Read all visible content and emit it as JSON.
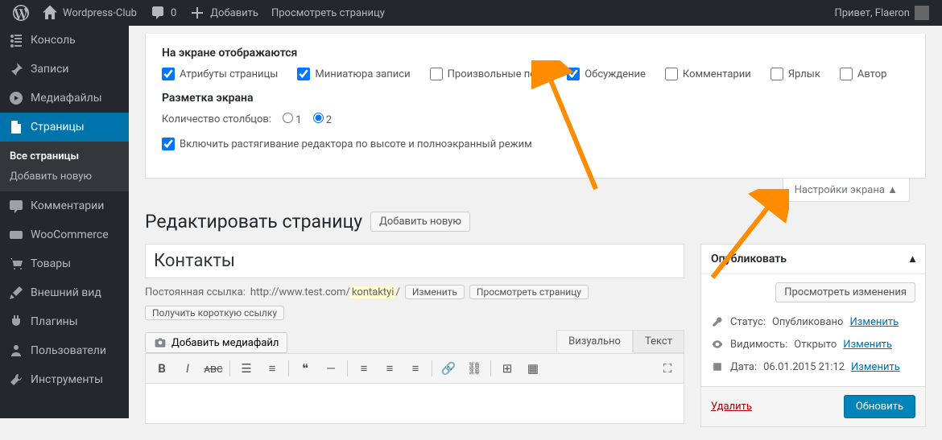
{
  "adminbar": {
    "site_name": "Wordpress-Club",
    "comments_count": "0",
    "new_label": "Добавить",
    "view_page": "Просмотреть страницу",
    "greeting": "Привет, Flaeron"
  },
  "sidebar": {
    "items": [
      {
        "label": "Консоль"
      },
      {
        "label": "Записи"
      },
      {
        "label": "Медиафайлы"
      },
      {
        "label": "Страницы"
      },
      {
        "label": "Комментарии"
      },
      {
        "label": "WooCommerce"
      },
      {
        "label": "Товары"
      },
      {
        "label": "Внешний вид"
      },
      {
        "label": "Плагины"
      },
      {
        "label": "Пользователи"
      },
      {
        "label": "Инструменты"
      }
    ],
    "submenu": {
      "all": "Все страницы",
      "add": "Добавить новую"
    }
  },
  "screen_options": {
    "heading1": "На экране отображаются",
    "checkboxes": [
      {
        "label": "Атрибуты страницы",
        "checked": true
      },
      {
        "label": "Миниатюра записи",
        "checked": true
      },
      {
        "label": "Произвольные поля",
        "checked": false
      },
      {
        "label": "Обсуждение",
        "checked": true
      },
      {
        "label": "Комментарии",
        "checked": false
      },
      {
        "label": "Ярлык",
        "checked": false
      },
      {
        "label": "Автор",
        "checked": false
      }
    ],
    "heading2": "Разметка экрана",
    "columns_label": "Количество столбцов:",
    "stretch_label": "Включить растягивание редактора по высоте и полноэкранный режим",
    "tab_label": "Настройки экрана"
  },
  "page": {
    "heading": "Редактировать страницу",
    "add_new": "Добавить новую",
    "title_value": "Контакты",
    "permalink_label": "Постоянная ссылка:",
    "permalink_url": "http://www.test.com/",
    "permalink_slug": "kontaktyi",
    "permalink_edit": "Изменить",
    "permalink_view": "Просмотреть страницу",
    "shortlink": "Получить короткую ссылку",
    "add_media": "Добавить медиафайл",
    "tab_visual": "Визуально",
    "tab_text": "Текст"
  },
  "publish": {
    "title": "Опубликовать",
    "preview": "Просмотреть изменения",
    "status_label": "Статус:",
    "status_value": "Опубликовано",
    "visibility_label": "Видимость:",
    "visibility_value": "Открыто",
    "date_label": "Дата:",
    "date_value": "06.01.2015 21:12",
    "edit": "Изменить",
    "delete": "Удалить",
    "update": "Обновить"
  }
}
